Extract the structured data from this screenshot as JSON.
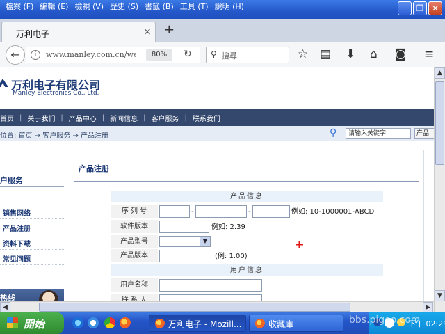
{
  "menubar": {
    "items": [
      "檔案 (F)",
      "編輯 (E)",
      "檢視 (V)",
      "歷史 (S)",
      "書籤 (B)",
      "工具 (T)",
      "說明 (H)"
    ]
  },
  "tab": {
    "title": "万利电子",
    "close": "×",
    "new": "+"
  },
  "navbar": {
    "url": "www.manley.com.cn/wel",
    "zoom": "80%",
    "search_placeholder": "搜尋"
  },
  "site": {
    "logo_cn": "万利电子有限公司",
    "logo_en": "Manley Electronics Co., Ltd.",
    "nav": [
      "首页",
      "关于我们",
      "产品中心",
      "新闻信息",
      "客户服务",
      "联系我们"
    ],
    "breadcrumb": "位置: 首页 → 客户服务 → 产品注册",
    "search_placeholder": "请输入关键字",
    "search_button": "产品"
  },
  "sidebar": {
    "heading": "户服务",
    "items": [
      "销售网络",
      "产品注册",
      "资料下载",
      "常见问题"
    ],
    "hotline": "热线"
  },
  "main": {
    "title": "产品注册",
    "section_product": "产品信息",
    "section_user": "用户信息",
    "fields": {
      "serial_label": "序 列 号",
      "serial_dash": "-",
      "serial_example": "例如: 10-1000001-ABCD",
      "software_label": "软件版本",
      "software_example": "例如: 2.39",
      "model_label": "产品型号",
      "product_version_label": "产品版本",
      "product_version_example": "(例: 1.00)",
      "username_label": "用户名称",
      "contact_label": "联 系 人"
    }
  },
  "taskbar": {
    "start": "開始",
    "tasks": [
      "万利电子 - Mozill...",
      "收藏庫"
    ],
    "clock": "下午 02:29",
    "watermark": "bbs.pigoo.com"
  }
}
